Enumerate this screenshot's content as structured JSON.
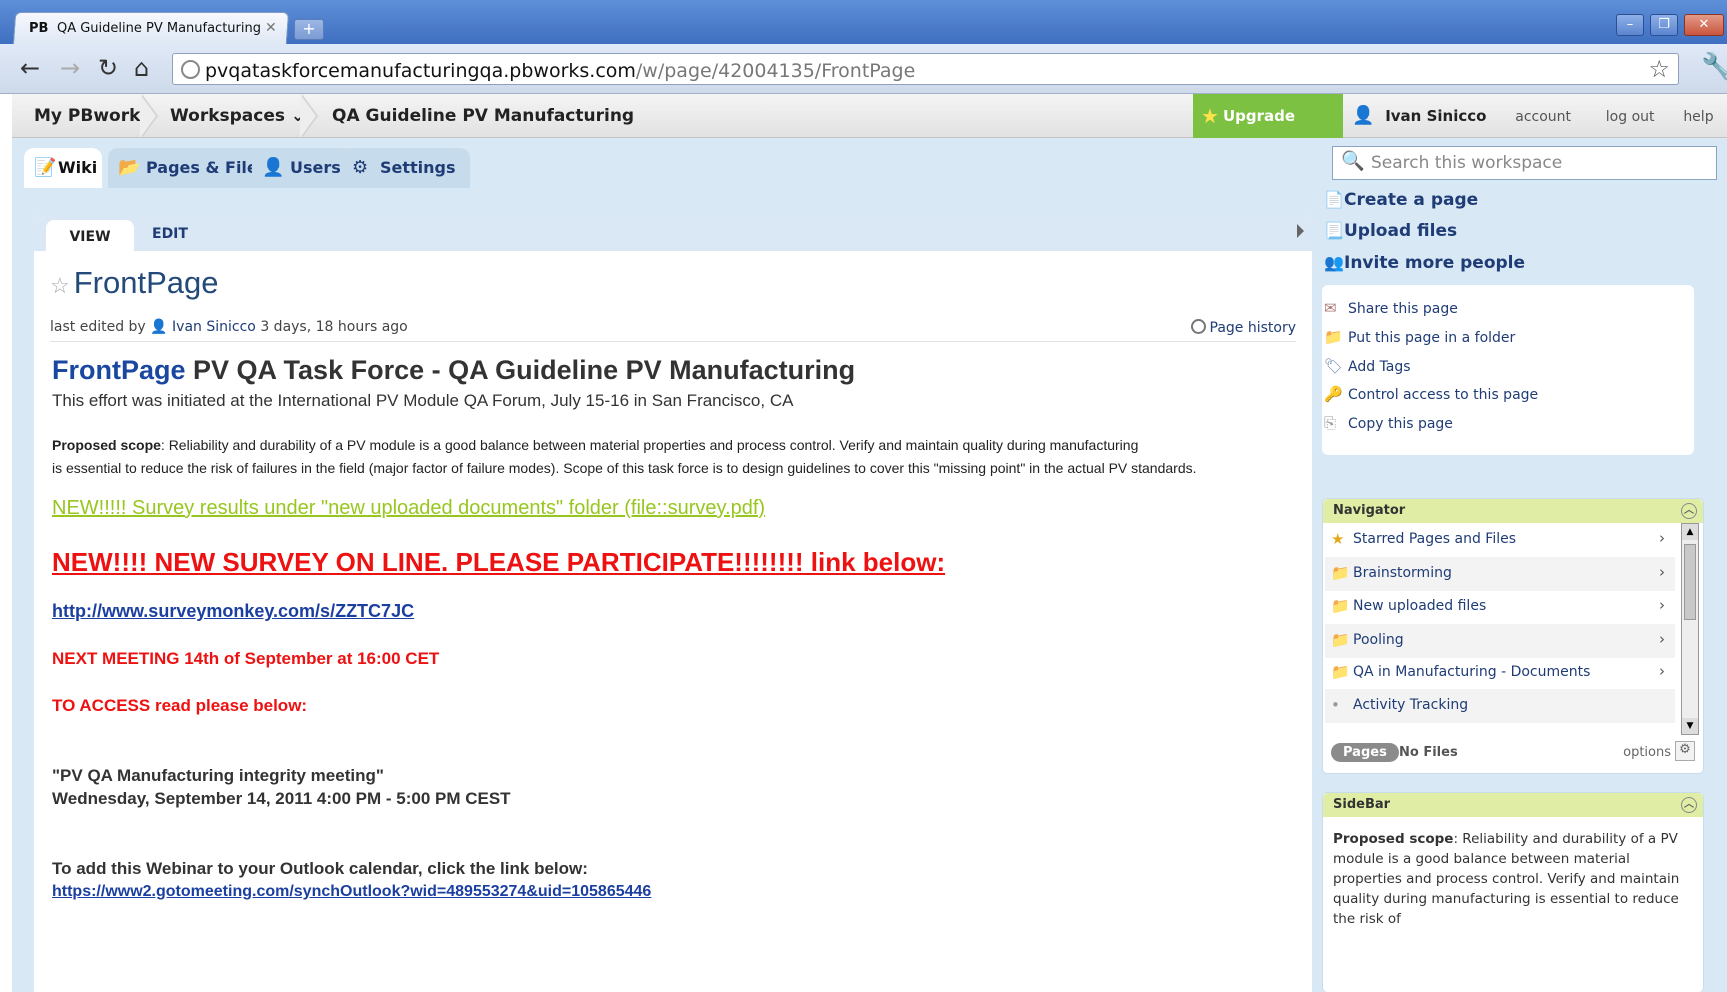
{
  "browser": {
    "tab_title": "QA Guideline PV Manufacturing",
    "tab_favicon": "PB",
    "url_host": "pvqataskforcemanufacturingqa.pbworks.com",
    "url_path": "/w/page/42004135/FrontPage"
  },
  "topbar": {
    "my_pbworks": "My PBworks",
    "workspaces": "Workspaces",
    "workspace_title": "QA Guideline PV Manufacturing",
    "upgrade": "Upgrade Now!",
    "user": "Ivan Sinicco",
    "account": "account",
    "logout": "log out",
    "help": "help"
  },
  "tabs": {
    "wiki": "Wiki",
    "pages_files": "Pages & Files",
    "users": "Users",
    "settings": "Settings",
    "search_placeholder": "Search this workspace"
  },
  "page": {
    "view_tab": "VIEW",
    "edit_tab": "EDIT",
    "title": "FrontPage",
    "last_edited_prefix": "last edited by",
    "last_edited_user": "Ivan Sinicco",
    "last_edited_when": "3 days, 18 hours ago",
    "page_history": "Page history"
  },
  "content": {
    "heading_link": "FrontPage",
    "heading_rest": "PV QA Task Force - QA Guideline PV Manufacturing",
    "subheading": "This effort was initiated at the International PV Module QA Forum, July 15-16 in San Francisco, CA",
    "scope_label": "Proposed scope",
    "scope_line1": ":  Reliability and durability of a PV module is a good balance between material properties and process control. Verify and maintain quality during manufacturing",
    "scope_line2": "is essential to reduce the risk of failures in the field (major factor of failure modes). Scope of this task force is to design guidelines to cover this \"missing point\" in the actual PV standards.",
    "new_survey_results": "NEW!!!!! Survey results under \"new uploaded documents\" folder (file::survey.pdf)",
    "new_survey": "NEW!!!! NEW SURVEY ON LINE. PLEASE PARTICIPATE!!!!!!!! link below:",
    "survey_link": "http://www.surveymonkey.com/s/ZZTC7JC",
    "next_meeting": "NEXT MEETING 14th of September at 16:00 CET",
    "to_access": "TO ACCESS read please below:",
    "meeting_name": "\"PV QA Manufacturing integrity meeting\"",
    "meeting_time": "Wednesday, September 14, 2011 4:00 PM - 5:00 PM CEST",
    "outlook_text": "To add this Webinar to your Outlook calendar, click the link below:",
    "outlook_link": "https://www2.gotomeeting.com/synchOutlook?wid=489553274&uid=105865446"
  },
  "actions": {
    "create_page": "Create a page",
    "upload_files": "Upload files",
    "invite_people": "Invite more people",
    "share": "Share this page",
    "folder": "Put this page in a folder",
    "tags": "Add Tags",
    "access": "Control access to this page",
    "copy": "Copy this page"
  },
  "navigator": {
    "title": "Navigator",
    "items": [
      {
        "label": "Starred Pages and Files"
      },
      {
        "label": "Brainstorming"
      },
      {
        "label": "New uploaded files"
      },
      {
        "label": "Pooling"
      },
      {
        "label": "QA in Manufacturing - Documents"
      },
      {
        "label": "Activity Tracking"
      }
    ],
    "pages_btn": "Pages",
    "no_files": "No Files",
    "options": "options"
  },
  "sidebar": {
    "title": "SideBar",
    "scope_label": "Proposed scope",
    "scope_text": ":  Reliability and durability of a PV module is a good balance between material properties and process control. Verify and maintain quality during manufacturing is essential to reduce the risk of"
  }
}
